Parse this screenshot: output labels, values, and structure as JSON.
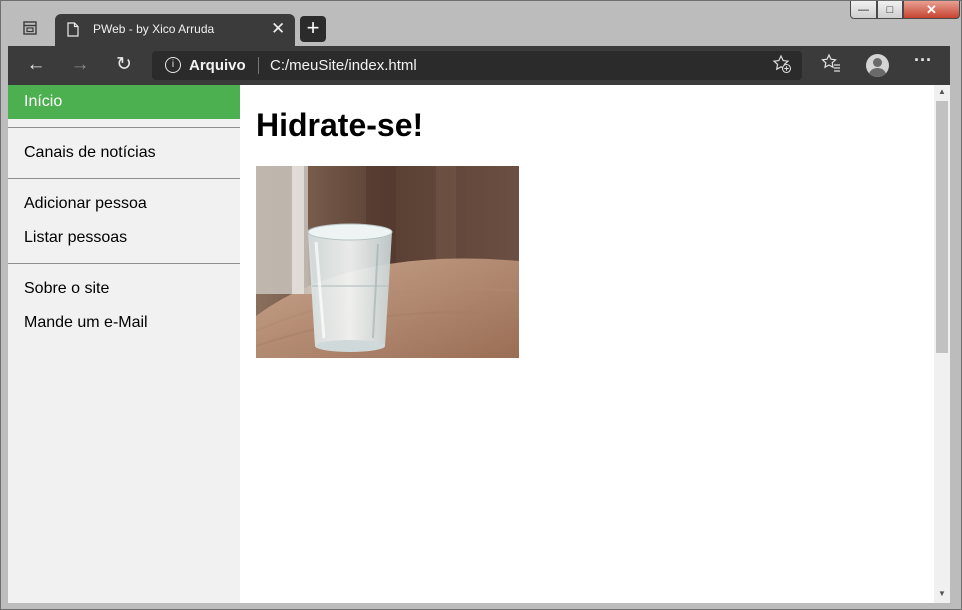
{
  "browser": {
    "tab_title": "PWeb - by Xico Arruda",
    "tab_close": "✕",
    "new_tab": "+",
    "nav": {
      "back": "←",
      "forward": "→",
      "reload": "↻"
    },
    "address": {
      "info": "i",
      "scheme_label": "Arquivo",
      "url": "C:/meuSite/index.html"
    },
    "toolbar_icons": [
      "favorites-add-icon",
      "favorites-icon",
      "profile-icon",
      "more-icon"
    ],
    "more": "···",
    "window_controls": {
      "minimize": "—",
      "maximize": "□",
      "close": "✕"
    }
  },
  "sidebar": {
    "groups": [
      [
        {
          "label": "Início",
          "active": true
        }
      ],
      [
        {
          "label": "Canais de notícias"
        }
      ],
      [
        {
          "label": "Adicionar pessoa"
        },
        {
          "label": "Listar pessoas"
        }
      ],
      [
        {
          "label": "Sobre o site"
        },
        {
          "label": "Mande um e-Mail"
        }
      ]
    ],
    "active_color": "#4caf50"
  },
  "main": {
    "heading": "Hidrate-se!",
    "image": "photo of a glass of water on a wooden table"
  }
}
